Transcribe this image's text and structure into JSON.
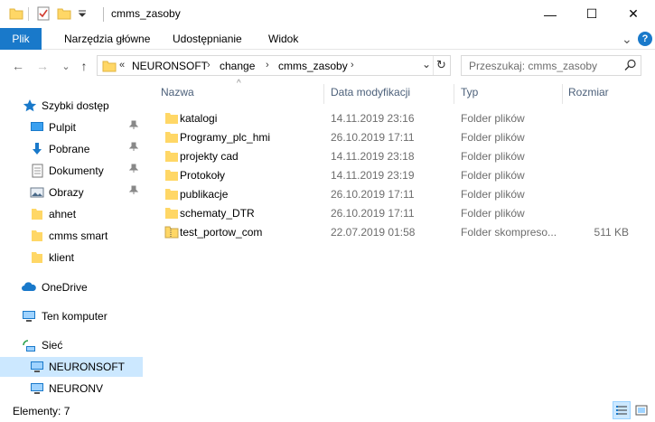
{
  "window": {
    "title": "cmms_zasoby",
    "minimize_glyph": "—",
    "maximize_glyph": "☐",
    "close_glyph": "✕"
  },
  "ribbon": {
    "tabs": [
      "Plik",
      "Narzędzia główne",
      "Udostępnianie",
      "Widok"
    ],
    "expand_glyph": "⌄",
    "help_glyph": "?"
  },
  "nav": {
    "back_glyph": "←",
    "forward_glyph": "→",
    "history_glyph": "⌄",
    "up_glyph": "↑",
    "overflow": "«",
    "breadcrumbs": [
      "NEURONSOFT",
      "change",
      "cmms_zasoby"
    ],
    "separator": "›",
    "dropdown_glyph": "⌄",
    "refresh_glyph": "↻"
  },
  "search": {
    "placeholder": "Przeszukaj: cmms_zasoby",
    "icon": "search-icon"
  },
  "sidebar": {
    "quick_access": "Szybki dostęp",
    "pinned": [
      {
        "label": "Pulpit",
        "icon": "desktop-icon"
      },
      {
        "label": "Pobrane",
        "icon": "download-icon"
      },
      {
        "label": "Dokumenty",
        "icon": "documents-icon"
      },
      {
        "label": "Obrazy",
        "icon": "pictures-icon"
      }
    ],
    "folders": [
      {
        "label": "ahnet"
      },
      {
        "label": "cmms smart"
      },
      {
        "label": "klient"
      }
    ],
    "onedrive": "OneDrive",
    "this_pc": "Ten komputer",
    "network": "Sieć",
    "network_items": [
      {
        "label": "NEURONSOFT",
        "selected": true
      },
      {
        "label": "NEURONV",
        "selected": false
      }
    ],
    "pin_glyph": "📌"
  },
  "columns": {
    "name": "Nazwa",
    "date": "Data modyfikacji",
    "type": "Typ",
    "size": "Rozmiar",
    "sort_glyph": "^"
  },
  "files": [
    {
      "name": "katalogi",
      "date": "14.11.2019 23:16",
      "type": "Folder plików",
      "size": "",
      "icon": "folder-icon"
    },
    {
      "name": "Programy_plc_hmi",
      "date": "26.10.2019 17:11",
      "type": "Folder plików",
      "size": "",
      "icon": "folder-icon"
    },
    {
      "name": "projekty cad",
      "date": "14.11.2019 23:18",
      "type": "Folder plików",
      "size": "",
      "icon": "folder-icon"
    },
    {
      "name": "Protokoły",
      "date": "14.11.2019 23:19",
      "type": "Folder plików",
      "size": "",
      "icon": "folder-icon"
    },
    {
      "name": "publikacje",
      "date": "26.10.2019 17:11",
      "type": "Folder plików",
      "size": "",
      "icon": "folder-icon"
    },
    {
      "name": "schematy_DTR",
      "date": "26.10.2019 17:11",
      "type": "Folder plików",
      "size": "",
      "icon": "folder-icon"
    },
    {
      "name": "test_portow_com",
      "date": "22.07.2019 01:58",
      "type": "Folder skompreso...",
      "size": "511 KB",
      "icon": "zip-folder-icon"
    }
  ],
  "status": {
    "items": "Elementy: 7"
  },
  "colors": {
    "accent": "#1979ca",
    "selection": "#cce8ff",
    "folder": "#ffd766"
  }
}
